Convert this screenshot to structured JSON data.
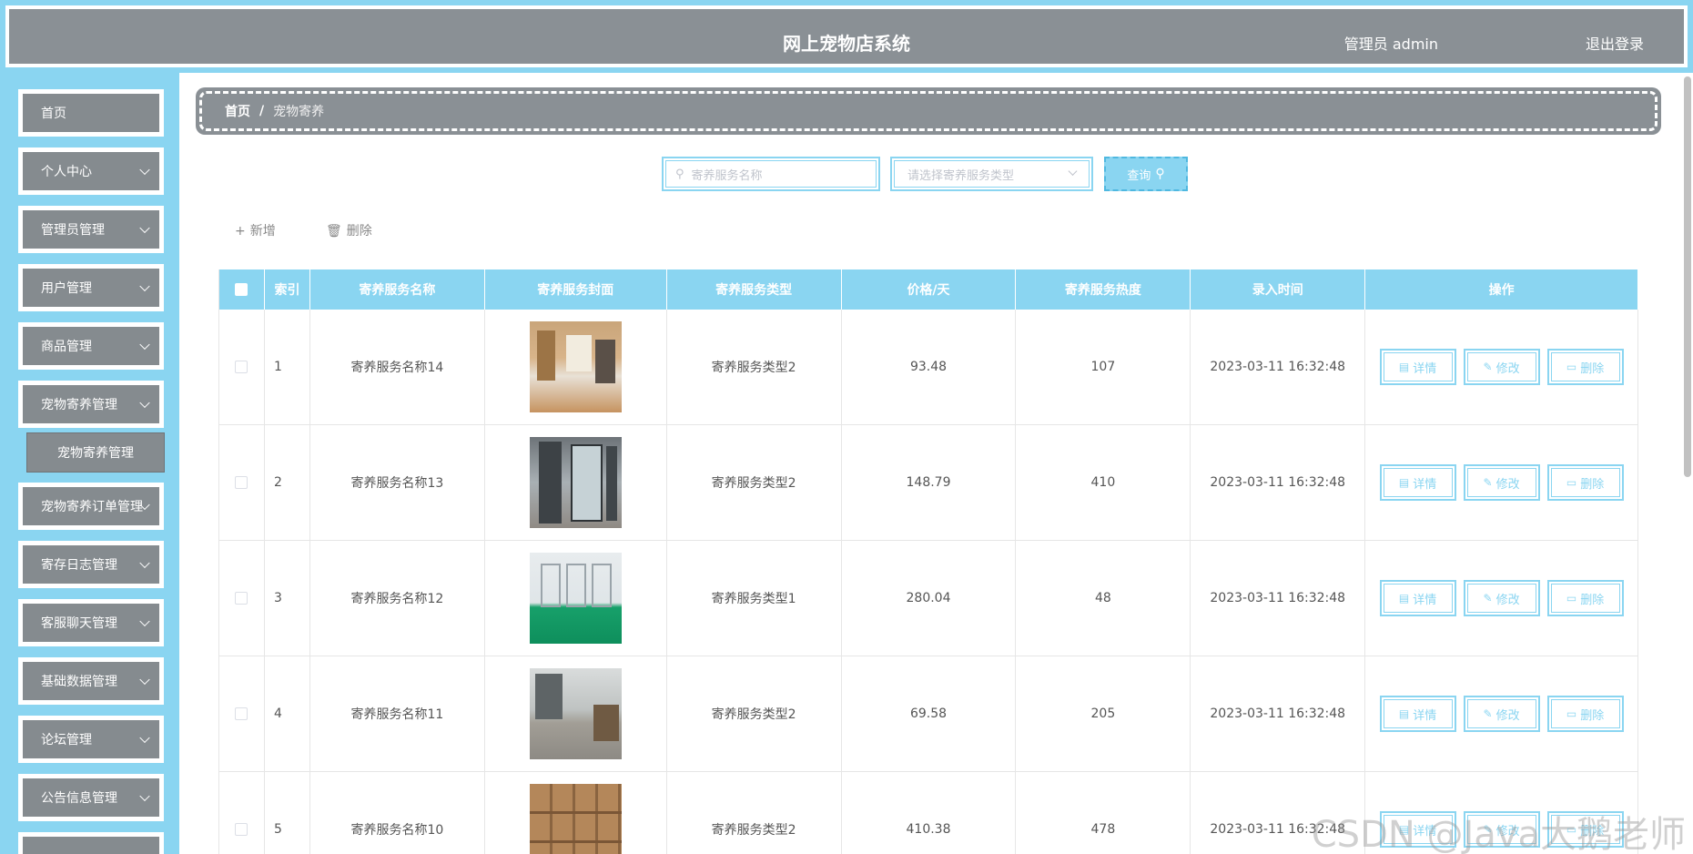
{
  "header": {
    "title": "网上宠物店系统",
    "user": "管理员 admin",
    "logout": "退出登录"
  },
  "sidebar": {
    "items": [
      {
        "label": "首页",
        "has_children": false
      },
      {
        "label": "个人中心",
        "has_children": true
      },
      {
        "label": "管理员管理",
        "has_children": true
      },
      {
        "label": "用户管理",
        "has_children": true
      },
      {
        "label": "商品管理",
        "has_children": true
      },
      {
        "label": "宠物寄养管理",
        "has_children": true
      },
      {
        "label": "宠物寄养订单管理",
        "has_children": true
      },
      {
        "label": "寄存日志管理",
        "has_children": true
      },
      {
        "label": "客服聊天管理",
        "has_children": true
      },
      {
        "label": "基础数据管理",
        "has_children": true
      },
      {
        "label": "论坛管理",
        "has_children": true
      },
      {
        "label": "公告信息管理",
        "has_children": true
      }
    ],
    "sub_item": "宠物寄养管理"
  },
  "breadcrumb": {
    "home": "首页",
    "separator": "/",
    "current": "宠物寄养"
  },
  "search": {
    "name_placeholder": "寄养服务名称",
    "type_placeholder": "请选择寄养服务类型",
    "button": "查询"
  },
  "actions": {
    "add": "新增",
    "delete": "删除"
  },
  "table": {
    "headers": {
      "index": "索引",
      "name": "寄养服务名称",
      "cover": "寄养服务封面",
      "type": "寄养服务类型",
      "price": "价格/天",
      "heat": "寄养服务热度",
      "time": "录入时间",
      "ops": "操作"
    },
    "rows": [
      {
        "index": "1",
        "name": "寄养服务名称14",
        "type": "寄养服务类型2",
        "price": "93.48",
        "heat": "107",
        "time": "2023-03-11 16:32:48"
      },
      {
        "index": "2",
        "name": "寄养服务名称13",
        "type": "寄养服务类型2",
        "price": "148.79",
        "heat": "410",
        "time": "2023-03-11 16:32:48"
      },
      {
        "index": "3",
        "name": "寄养服务名称12",
        "type": "寄养服务类型1",
        "price": "280.04",
        "heat": "48",
        "time": "2023-03-11 16:32:48"
      },
      {
        "index": "4",
        "name": "寄养服务名称11",
        "type": "寄养服务类型2",
        "price": "69.58",
        "heat": "205",
        "time": "2023-03-11 16:32:48"
      },
      {
        "index": "5",
        "name": "寄养服务名称10",
        "type": "寄养服务类型2",
        "price": "410.38",
        "heat": "478",
        "time": "2023-03-11 16:32:48"
      }
    ],
    "op_labels": {
      "detail": "详情",
      "edit": "修改",
      "delete": "删除"
    }
  },
  "watermark": "CSDN @Java大鹅老师",
  "colors": {
    "accent": "#8ad5f1",
    "header_bg": "#8a9095",
    "menu_bg": "#858b8f"
  }
}
